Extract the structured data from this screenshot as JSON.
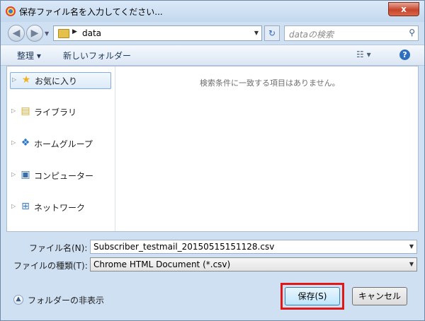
{
  "window": {
    "title": "保存ファイル名を入力してください...",
    "close_label": "x"
  },
  "navbar": {
    "back_icon": "back-arrow-icon",
    "forward_icon": "forward-arrow-icon",
    "path": "data",
    "search_placeholder": "dataの検索"
  },
  "toolbar": {
    "organize": "整理 ▾",
    "new_folder": "新しいフォルダー"
  },
  "sidebar": {
    "items": [
      {
        "label": "お気に入り",
        "icon": "star-icon"
      },
      {
        "label": "ライブラリ",
        "icon": "library-icon"
      },
      {
        "label": "ホームグループ",
        "icon": "homegroup-icon"
      },
      {
        "label": "コンピューター",
        "icon": "computer-icon"
      },
      {
        "label": "ネットワーク",
        "icon": "network-icon"
      }
    ]
  },
  "main": {
    "empty_message": "検索条件に一致する項目はありません。"
  },
  "fields": {
    "filename_label": "ファイル名(N):",
    "filename_value": "Subscriber_testmail_20150515151128.csv",
    "filetype_label": "ファイルの種類(T):",
    "filetype_value": "Chrome HTML Document (*.csv)"
  },
  "footer": {
    "hide_folders": "フォルダーの非表示",
    "save": "保存(S)",
    "cancel": "キャンセル"
  },
  "colors": {
    "highlight": "#e11818",
    "accent": "#2f6fc0"
  }
}
